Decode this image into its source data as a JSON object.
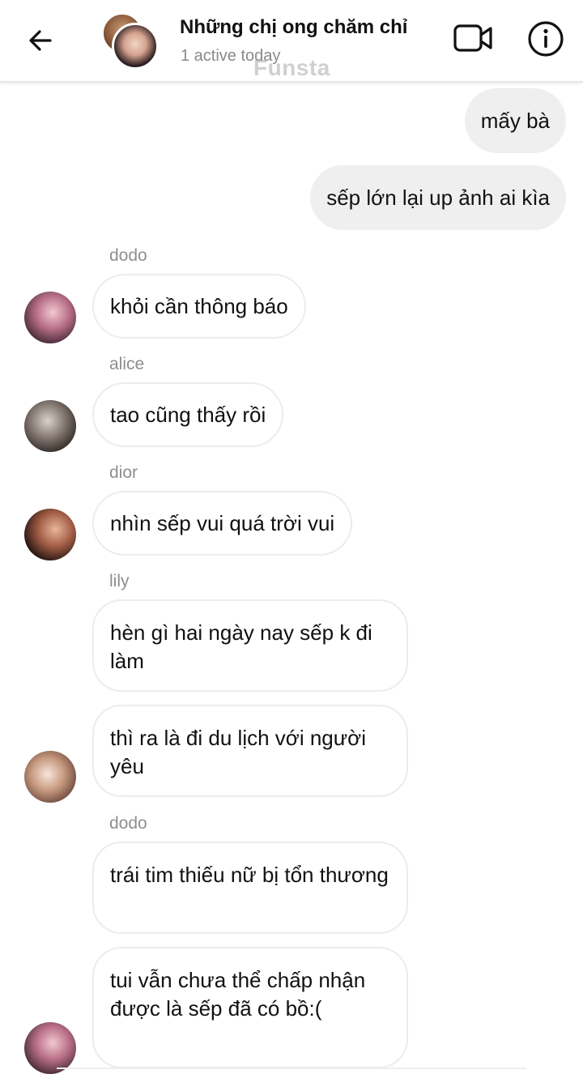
{
  "header": {
    "back_icon": "arrow-left-icon",
    "title": "Những chị ong chăm chỉ",
    "subtitle": "1 active today",
    "watermark": "Funsta",
    "video_icon": "video-call-icon",
    "info_icon": "info-icon"
  },
  "messages": {
    "out1": "mấy bà",
    "out2": "sếp lớn lại up ảnh ai kìa",
    "sender_dodo": "dodo",
    "msg_dodo1": "khỏi cần thông báo",
    "sender_alice": "alice",
    "msg_alice": "tao cũng thấy rồi",
    "sender_dior": "dior",
    "msg_dior": "nhìn sếp vui quá trời vui",
    "sender_lily": "lily",
    "msg_lily1": "hèn gì hai ngày nay sếp k đi làm",
    "msg_lily2": "thì ra là đi du lịch với người yêu",
    "sender_dodo2": "dodo",
    "msg_dodo2": "trái tim thiếu nữ bị tổn thương",
    "msg_dodo3": "tui vẫn chưa thể chấp nhận được là sếp đã có bồ:("
  }
}
